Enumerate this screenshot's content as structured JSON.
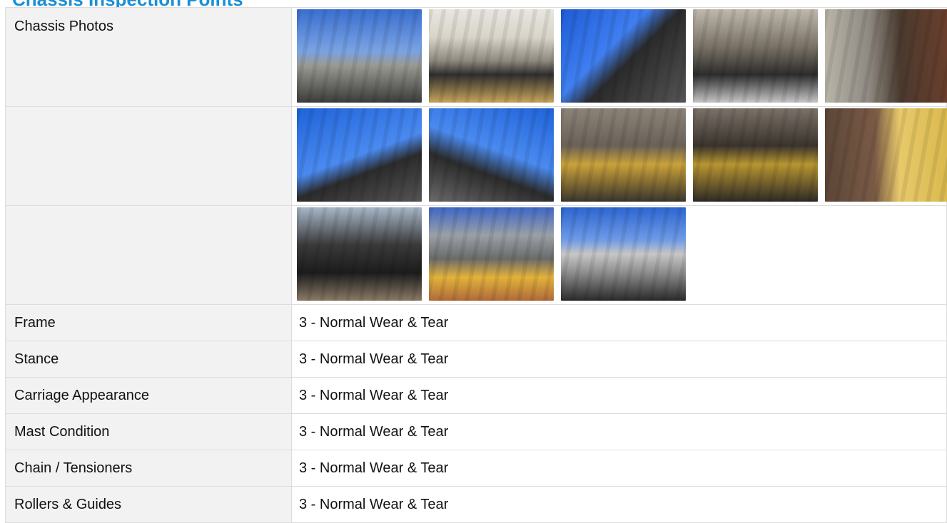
{
  "section": {
    "title": "Chassis Inspection Points"
  },
  "photos": {
    "label": "Chassis Photos",
    "rows": [
      [
        {
          "description": "forklift mast exterior"
        },
        {
          "description": "forklift front tire and fork"
        },
        {
          "description": "mast channel against sky"
        },
        {
          "description": "carriage roller close-up"
        },
        {
          "description": "mast bracket close-up"
        }
      ],
      [
        {
          "description": "mast uprights looking up"
        },
        {
          "description": "mast uprights angle"
        },
        {
          "description": "chain anchor close-up"
        },
        {
          "description": "chain anchor detail"
        },
        {
          "description": "carriage bracket side"
        }
      ],
      [
        {
          "description": "tilt cylinder"
        },
        {
          "description": "forklift side with tire"
        },
        {
          "description": "forklift mast in lot"
        }
      ]
    ]
  },
  "inspection_items": [
    {
      "label": "Frame",
      "value": "3 - Normal Wear & Tear"
    },
    {
      "label": "Stance",
      "value": "3 - Normal Wear & Tear"
    },
    {
      "label": "Carriage Appearance",
      "value": "3 - Normal Wear & Tear"
    },
    {
      "label": "Mast Condition",
      "value": "3 - Normal Wear & Tear"
    },
    {
      "label": "Chain / Tensioners",
      "value": "3 - Normal Wear & Tear"
    },
    {
      "label": "Rollers & Guides",
      "value": "3 - Normal Wear & Tear"
    }
  ],
  "colors": {
    "title": "#1b8fd6",
    "label_bg": "#f2f2f2",
    "border": "#dcdcdc"
  }
}
